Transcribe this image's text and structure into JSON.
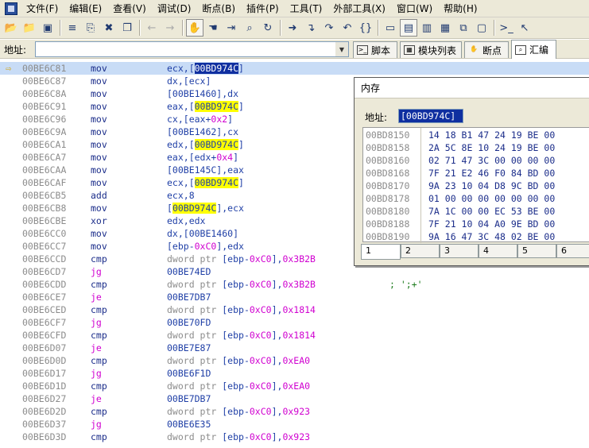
{
  "menus": [
    "文件(F)",
    "编辑(E)",
    "查看(V)",
    "调试(D)",
    "断点(B)",
    "插件(P)",
    "工具(T)",
    "外部工具(X)",
    "窗口(W)",
    "帮助(H)"
  ],
  "toolbar_icons": [
    "open-icon",
    "open-folder-icon",
    "save-icon",
    "list-icon",
    "copy-icon",
    "delete-icon",
    "pages-icon",
    "back-arrow-icon",
    "forward-arrow-icon",
    "hand-icon",
    "hand-run-icon",
    "step-icon",
    "search-window-icon",
    "refresh-icon",
    "run-icon",
    "step-into-icon",
    "step-over-icon",
    "step-out-icon",
    "braces-icon",
    "console-icon",
    "cpu-window-icon",
    "memory-window-icon",
    "modules-icon",
    "threads-icon",
    "window-icon",
    "terminal-icon",
    "pointer-icon"
  ],
  "address_bar": {
    "label": "地址:",
    "value": ""
  },
  "top_tabs": [
    {
      "label": "脚本",
      "icon": "script-icon"
    },
    {
      "label": "模块列表",
      "icon": "module-list-icon"
    },
    {
      "label": "断点",
      "icon": "breakpoint-icon"
    },
    {
      "label": "汇编",
      "icon": "disasm-icon"
    }
  ],
  "disasm": {
    "rows": [
      {
        "addr": "00BE6C81",
        "mnem": "mov",
        "ops": [
          {
            "t": "ecx,["
          },
          {
            "t": "00BD974C",
            "k": "hlsel"
          },
          {
            "t": "]"
          }
        ],
        "current": true
      },
      {
        "addr": "00BE6C87",
        "mnem": "mov",
        "ops": [
          {
            "t": "dx,[ecx]"
          }
        ]
      },
      {
        "addr": "00BE6C8A",
        "mnem": "mov",
        "ops": [
          {
            "t": "[00BE1460],dx"
          }
        ]
      },
      {
        "addr": "00BE6C91",
        "mnem": "mov",
        "ops": [
          {
            "t": "eax,["
          },
          {
            "t": "00BD974C",
            "k": "hl"
          },
          {
            "t": "]"
          }
        ]
      },
      {
        "addr": "00BE6C96",
        "mnem": "mov",
        "ops": [
          {
            "t": "cx,[eax+"
          },
          {
            "t": "0x2",
            "k": "num"
          },
          {
            "t": "]"
          }
        ]
      },
      {
        "addr": "00BE6C9A",
        "mnem": "mov",
        "ops": [
          {
            "t": "[00BE1462],cx"
          }
        ]
      },
      {
        "addr": "00BE6CA1",
        "mnem": "mov",
        "ops": [
          {
            "t": "edx,["
          },
          {
            "t": "00BD974C",
            "k": "hl"
          },
          {
            "t": "]"
          }
        ]
      },
      {
        "addr": "00BE6CA7",
        "mnem": "mov",
        "ops": [
          {
            "t": "eax,[edx+"
          },
          {
            "t": "0x4",
            "k": "num"
          },
          {
            "t": "]"
          }
        ]
      },
      {
        "addr": "00BE6CAA",
        "mnem": "mov",
        "ops": [
          {
            "t": "[00BE145C],eax"
          }
        ]
      },
      {
        "addr": "00BE6CAF",
        "mnem": "mov",
        "ops": [
          {
            "t": "ecx,["
          },
          {
            "t": "00BD974C",
            "k": "hl"
          },
          {
            "t": "]"
          }
        ]
      },
      {
        "addr": "00BE6CB5",
        "mnem": "add",
        "ops": [
          {
            "t": "ecx,8"
          }
        ]
      },
      {
        "addr": "00BE6CB8",
        "mnem": "mov",
        "ops": [
          {
            "t": "["
          },
          {
            "t": "00BD974C",
            "k": "hl"
          },
          {
            "t": "],ecx"
          }
        ]
      },
      {
        "addr": "00BE6CBE",
        "mnem": "xor",
        "ops": [
          {
            "t": "edx,edx"
          }
        ]
      },
      {
        "addr": "00BE6CC0",
        "mnem": "mov",
        "ops": [
          {
            "t": "dx,[00BE1460]"
          }
        ]
      },
      {
        "addr": "00BE6CC7",
        "mnem": "mov",
        "ops": [
          {
            "t": "[ebp-"
          },
          {
            "t": "0xC0",
            "k": "num"
          },
          {
            "t": "],edx"
          }
        ]
      },
      {
        "addr": "00BE6CCD",
        "mnem": "cmp",
        "ops": [
          {
            "t": "dword ptr ",
            "k": "ptr"
          },
          {
            "t": "[ebp-"
          },
          {
            "t": "0xC0",
            "k": "num"
          },
          {
            "t": "],"
          },
          {
            "t": "0x3B2B",
            "k": "num"
          }
        ]
      },
      {
        "addr": "00BE6CD7",
        "mnem": "jg",
        "jmp": true,
        "ops": [
          {
            "t": "00BE74ED"
          }
        ]
      },
      {
        "addr": "00BE6CDD",
        "mnem": "cmp",
        "ops": [
          {
            "t": "dword ptr ",
            "k": "ptr"
          },
          {
            "t": "[ebp-"
          },
          {
            "t": "0xC0",
            "k": "num"
          },
          {
            "t": "],"
          },
          {
            "t": "0x3B2B",
            "k": "num"
          }
        ],
        "comment": "; ';+'"
      },
      {
        "addr": "00BE6CE7",
        "mnem": "je",
        "jmp": true,
        "ops": [
          {
            "t": "00BE7DB7"
          }
        ]
      },
      {
        "addr": "00BE6CED",
        "mnem": "cmp",
        "ops": [
          {
            "t": "dword ptr ",
            "k": "ptr"
          },
          {
            "t": "[ebp-"
          },
          {
            "t": "0xC0",
            "k": "num"
          },
          {
            "t": "],"
          },
          {
            "t": "0x1814",
            "k": "num"
          }
        ]
      },
      {
        "addr": "00BE6CF7",
        "mnem": "jg",
        "jmp": true,
        "ops": [
          {
            "t": "00BE70FD"
          }
        ]
      },
      {
        "addr": "00BE6CFD",
        "mnem": "cmp",
        "ops": [
          {
            "t": "dword ptr ",
            "k": "ptr"
          },
          {
            "t": "[ebp-"
          },
          {
            "t": "0xC0",
            "k": "num"
          },
          {
            "t": "],"
          },
          {
            "t": "0x1814",
            "k": "num"
          }
        ]
      },
      {
        "addr": "00BE6D07",
        "mnem": "je",
        "jmp": true,
        "ops": [
          {
            "t": "00BE7E87"
          }
        ]
      },
      {
        "addr": "00BE6D0D",
        "mnem": "cmp",
        "ops": [
          {
            "t": "dword ptr ",
            "k": "ptr"
          },
          {
            "t": "[ebp-"
          },
          {
            "t": "0xC0",
            "k": "num"
          },
          {
            "t": "],"
          },
          {
            "t": "0xEA0",
            "k": "num"
          }
        ]
      },
      {
        "addr": "00BE6D17",
        "mnem": "jg",
        "jmp": true,
        "ops": [
          {
            "t": "00BE6F1D"
          }
        ]
      },
      {
        "addr": "00BE6D1D",
        "mnem": "cmp",
        "ops": [
          {
            "t": "dword ptr ",
            "k": "ptr"
          },
          {
            "t": "[ebp-"
          },
          {
            "t": "0xC0",
            "k": "num"
          },
          {
            "t": "],"
          },
          {
            "t": "0xEA0",
            "k": "num"
          }
        ]
      },
      {
        "addr": "00BE6D27",
        "mnem": "je",
        "jmp": true,
        "ops": [
          {
            "t": "00BE7DB7"
          }
        ]
      },
      {
        "addr": "00BE6D2D",
        "mnem": "cmp",
        "ops": [
          {
            "t": "dword ptr ",
            "k": "ptr"
          },
          {
            "t": "[ebp-"
          },
          {
            "t": "0xC0",
            "k": "num"
          },
          {
            "t": "],"
          },
          {
            "t": "0x923",
            "k": "num"
          }
        ]
      },
      {
        "addr": "00BE6D37",
        "mnem": "jg",
        "jmp": true,
        "ops": [
          {
            "t": "00BE6E35"
          }
        ]
      },
      {
        "addr": "00BE6D3D",
        "mnem": "cmp",
        "ops": [
          {
            "t": "dword ptr ",
            "k": "ptr"
          },
          {
            "t": "[ebp-"
          },
          {
            "t": "0xC0",
            "k": "num"
          },
          {
            "t": "],"
          },
          {
            "t": "0x923",
            "k": "num"
          }
        ]
      }
    ]
  },
  "memory_window": {
    "title": "内存",
    "address_label": "地址:",
    "address_value": "[00BD974C]",
    "rows": [
      {
        "addr": "00BD8150",
        "bytes": "14 18 B1 47 24 19 BE 00"
      },
      {
        "addr": "00BD8158",
        "bytes": "2A 5C 8E 10 24 19 BE 00"
      },
      {
        "addr": "00BD8160",
        "bytes": "02 71 47 3C 00 00 00 00"
      },
      {
        "addr": "00BD8168",
        "bytes": "7F 21 E2 46 F0 84 BD 00"
      },
      {
        "addr": "00BD8170",
        "bytes": "9A 23 10 04 D8 9C BD 00"
      },
      {
        "addr": "00BD8178",
        "bytes": "01 00 00 00 00 00 00 00"
      },
      {
        "addr": "00BD8180",
        "bytes": "7A 1C 00 00 EC 53 BE 00"
      },
      {
        "addr": "00BD8188",
        "bytes": "7F 21 10 04 A0 9E BD 00"
      },
      {
        "addr": "00BD8190",
        "bytes": "9A 16 47 3C 48 02 BE 00"
      }
    ],
    "tabs": [
      "1",
      "2",
      "3",
      "4",
      "5",
      "6"
    ]
  }
}
